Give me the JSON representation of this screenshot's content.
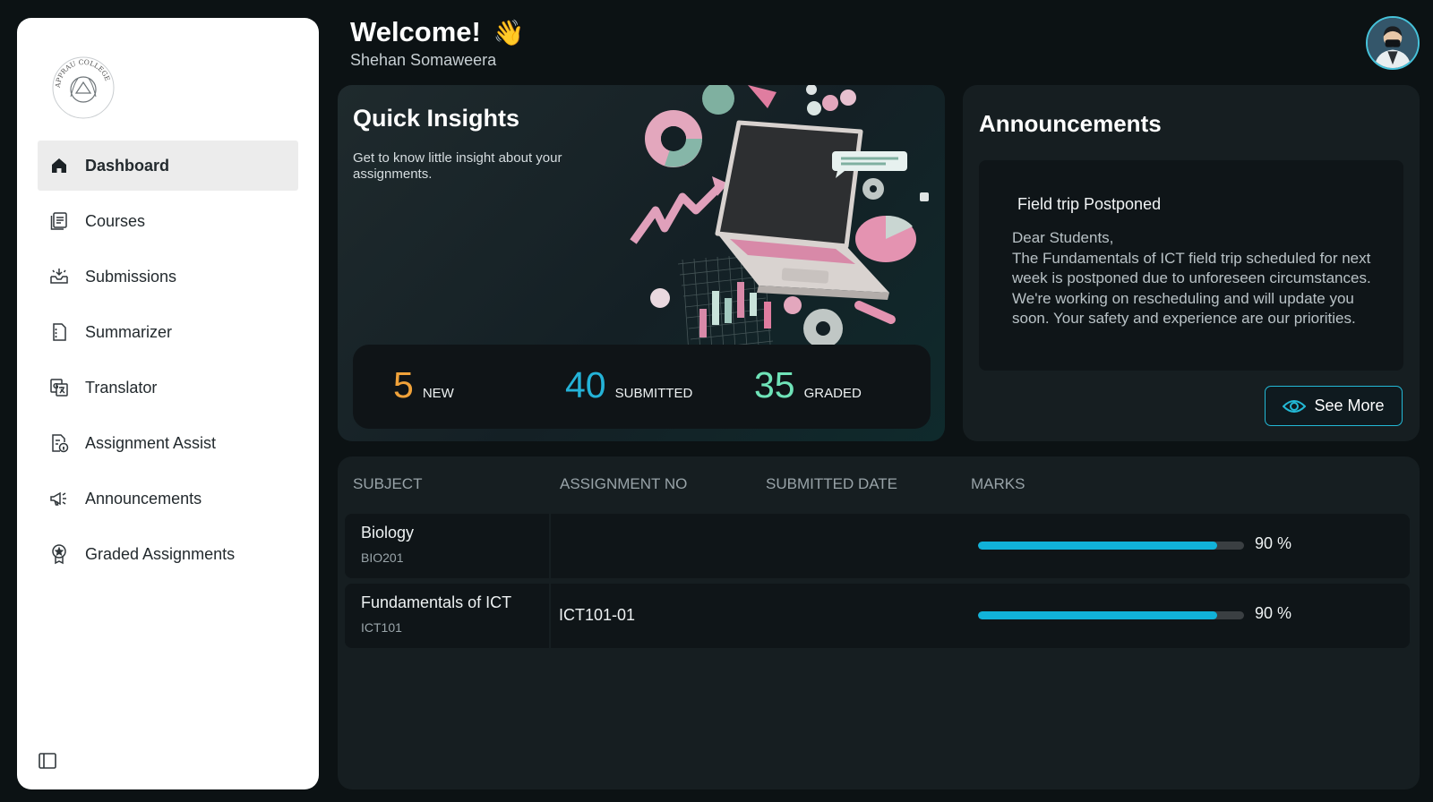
{
  "sidebar": {
    "logo_text": "APPRAU COLLEGE",
    "items": [
      {
        "label": "Dashboard",
        "icon": "home-icon",
        "active": true
      },
      {
        "label": "Courses",
        "icon": "courses-icon",
        "active": false
      },
      {
        "label": "Submissions",
        "icon": "inbox-icon",
        "active": false
      },
      {
        "label": "Summarizer",
        "icon": "document-icon",
        "active": false
      },
      {
        "label": "Translator",
        "icon": "translate-icon",
        "active": false
      },
      {
        "label": "Assignment Assist",
        "icon": "file-info-icon",
        "active": false
      },
      {
        "label": "Announcements",
        "icon": "megaphone-icon",
        "active": false
      },
      {
        "label": "Graded Assignments",
        "icon": "award-icon",
        "active": false
      }
    ],
    "collapse_icon": "sidebar-toggle-icon"
  },
  "header": {
    "welcome": "Welcome!",
    "wave": "👋",
    "username": "Shehan Somaweera"
  },
  "insights": {
    "title": "Quick Insights",
    "description": "Get to know little insight about your assignments.",
    "stats": [
      {
        "value": "5",
        "label": "NEW",
        "color": "#f0a23a"
      },
      {
        "value": "40",
        "label": "SUBMITTED",
        "color": "#24b3d8"
      },
      {
        "value": "35",
        "label": "GRADED",
        "color": "#6fe3b8"
      }
    ]
  },
  "announcements": {
    "title": "Announcements",
    "item_title": "Field trip Postponed",
    "item_body": "Dear Students,\nThe Fundamentals of ICT field trip scheduled for next week is postponed due to unforeseen circumstances. We're working on rescheduling and will update you soon. Your safety and experience are our priorities.",
    "see_more": "See More"
  },
  "table": {
    "headers": [
      "SUBJECT",
      "ASSIGNMENT NO",
      "SUBMITTED DATE",
      "MARKS"
    ],
    "rows": [
      {
        "subject": "Biology",
        "code": "BIO201",
        "assignment": "",
        "submitted": "",
        "marks": 90,
        "marks_label": "90 %"
      },
      {
        "subject": "Fundamentals of ICT",
        "code": "ICT101",
        "assignment": "ICT101-01",
        "submitted": "",
        "marks": 90,
        "marks_label": "90 %"
      }
    ]
  },
  "colors": {
    "accent": "#11b2d9",
    "background": "#0c1214",
    "card": "#161e21"
  }
}
